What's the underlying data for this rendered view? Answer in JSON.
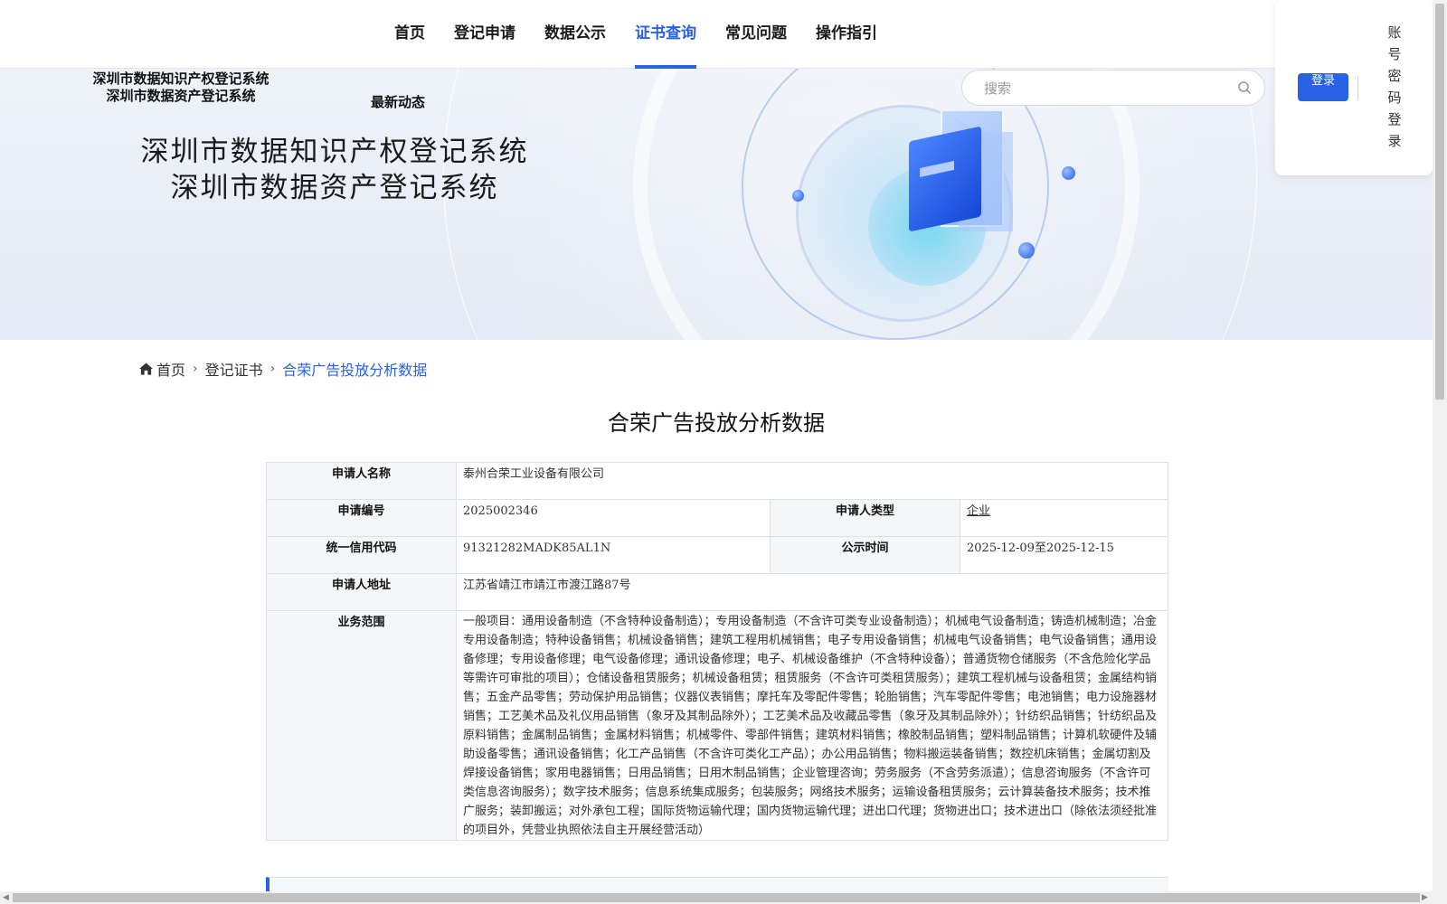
{
  "nav": {
    "items": [
      "首页",
      "登记申请",
      "数据公示",
      "证书查询",
      "常见问题",
      "操作指引"
    ],
    "active_index": 3
  },
  "header": {
    "system_names": [
      "深圳市数据知识产权登记系统",
      "深圳市数据资产登记系统"
    ],
    "news": "最新动态",
    "search_placeholder": "搜索",
    "login_button": "登录",
    "password_login": "账号密码登录"
  },
  "banner": {
    "titles": [
      "深圳市数据知识产权登记系统",
      "深圳市数据资产登记系统"
    ]
  },
  "breadcrumb": {
    "home": "首页",
    "level2": "登记证书",
    "current": "合荣广告投放分析数据"
  },
  "page_title": "合荣广告投放分析数据",
  "details": {
    "applicant_name_label": "申请人名称",
    "applicant_name": "泰州合荣工业设备有限公司",
    "application_no_label": "申请编号",
    "application_no": "2025002346",
    "applicant_type_label": "申请人类型",
    "applicant_type": "企业",
    "credit_code_label": "统一信用代码",
    "credit_code": "91321282MADK85AL1N",
    "publicity_label": "公示时间",
    "publicity_period": "2025-12-09至2025-12-15",
    "address_label": "申请人地址",
    "address": "江苏省靖江市靖江市渡江路87号",
    "scope_label": "业务范围",
    "scope": "一般项目：通用设备制造（不含特种设备制造）；专用设备制造（不含许可类专业设备制造）；机械电气设备制造；铸造机械制造；冶金专用设备制造；特种设备销售；机械设备销售；建筑工程用机械销售；电子专用设备销售；机械电气设备销售；电气设备销售；通用设备修理；专用设备修理；电气设备修理；通讯设备修理；电子、机械设备维护（不含特种设备）；普通货物仓储服务（不含危险化学品等需许可审批的项目）；仓储设备租赁服务；机械设备租赁；租赁服务（不含许可类租赁服务）；建筑工程机械与设备租赁；金属结构销售；五金产品零售；劳动保护用品销售；仪器仪表销售；摩托车及零配件零售；轮胎销售；汽车零配件零售；电池销售；电力设施器材销售；工艺美术品及礼仪用品销售（象牙及其制品除外）；工艺美术品及收藏品零售（象牙及其制品除外）；针纺织品销售；针纺织品及原料销售；金属制品销售；金属材料销售；机械零件、零部件销售；建筑材料销售；橡胶制品销售；塑料制品销售；计算机软硬件及辅助设备零售；通讯设备销售；化工产品销售（不含许可类化工产品）；办公用品销售；物料搬运装备销售；数控机床销售；金属切割及焊接设备销售；家用电器销售；日用品销售；日用木制品销售；企业管理咨询；劳务服务（不含劳务派遣）；信息咨询服务（不含许可类信息咨询服务）；数字技术服务；信息系统集成服务；包装服务；网络技术服务；运输设备租赁服务；云计算装备技术服务；技术推广服务；装卸搬运；对外承包工程；国际货物运输代理；国内货物运输代理；进出口代理；货物进出口；技术进出口（除依法须经批准的项目外，凭营业执照依法自主开展经营活动）"
  },
  "colors": {
    "accent": "#2a62e6",
    "label_bg": "#f5f6f8",
    "border": "#dde0e6"
  }
}
